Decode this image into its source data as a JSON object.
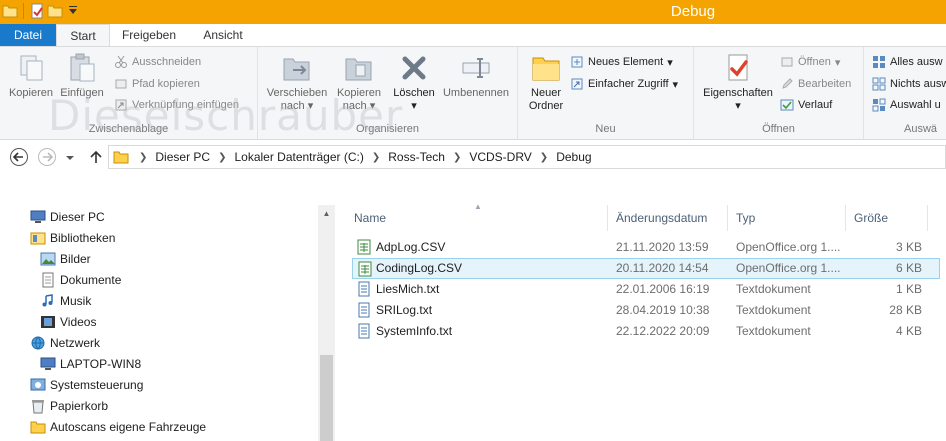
{
  "window": {
    "title": "Debug"
  },
  "tabs": {
    "file": "Datei",
    "start": "Start",
    "share": "Freigeben",
    "view": "Ansicht"
  },
  "watermark": "Dieselschrauber",
  "ribbon": {
    "clipboard": {
      "label": "Zwischenablage",
      "copy": "Kopieren",
      "paste": "Einfügen",
      "cut": "Ausschneiden",
      "copy_path": "Pfad kopieren",
      "paste_shortcut": "Verknüpfung einfügen"
    },
    "organize": {
      "label": "Organisieren",
      "move_to_1": "Verschieben",
      "move_to_2": "nach",
      "copy_to_1": "Kopieren",
      "copy_to_2": "nach",
      "delete": "Löschen",
      "rename": "Umbenennen"
    },
    "new": {
      "label": "Neu",
      "new_folder_1": "Neuer",
      "new_folder_2": "Ordner",
      "new_item": "Neues Element",
      "easy_access": "Einfacher Zugriff"
    },
    "open": {
      "label": "Öffnen",
      "properties": "Eigenschaften",
      "open": "Öffnen",
      "edit": "Bearbeiten",
      "history": "Verlauf"
    },
    "select": {
      "label": "Auswä",
      "select_all": "Alles ausw",
      "select_none": "Nichts ausw",
      "invert": "Auswahl u"
    }
  },
  "address": {
    "crumbs": [
      "Dieser PC",
      "Lokaler Datenträger (C:)",
      "Ross-Tech",
      "VCDS-DRV",
      "Debug"
    ]
  },
  "nav": [
    {
      "label": "Dieser PC",
      "icon": "computer-icon"
    },
    {
      "label": "Bibliotheken",
      "icon": "libraries-icon"
    },
    {
      "label": "Bilder",
      "icon": "pictures-icon"
    },
    {
      "label": "Dokumente",
      "icon": "documents-icon"
    },
    {
      "label": "Musik",
      "icon": "music-icon"
    },
    {
      "label": "Videos",
      "icon": "videos-icon"
    },
    {
      "label": "Netzwerk",
      "icon": "network-icon"
    },
    {
      "label": "LAPTOP-WIN8",
      "icon": "computer-icon"
    },
    {
      "label": "Systemsteuerung",
      "icon": "control-panel-icon"
    },
    {
      "label": "Papierkorb",
      "icon": "recycle-bin-icon"
    },
    {
      "label": "Autoscans eigene Fahrzeuge",
      "icon": "folder-icon"
    }
  ],
  "columns": {
    "name": "Name",
    "date": "Änderungsdatum",
    "type": "Typ",
    "size": "Größe"
  },
  "files": [
    {
      "name": "AdpLog.CSV",
      "date": "21.11.2020 13:59",
      "type": "OpenOffice.org 1....",
      "size": "3 KB",
      "kind": "csv"
    },
    {
      "name": "CodingLog.CSV",
      "date": "20.11.2020 14:54",
      "type": "OpenOffice.org 1....",
      "size": "6 KB",
      "kind": "csv"
    },
    {
      "name": "LiesMich.txt",
      "date": "22.01.2006 16:19",
      "type": "Textdokument",
      "size": "1 KB",
      "kind": "txt"
    },
    {
      "name": "SRILog.txt",
      "date": "28.04.2019 10:38",
      "type": "Textdokument",
      "size": "28 KB",
      "kind": "txt"
    },
    {
      "name": "SystemInfo.txt",
      "date": "22.12.2022 20:09",
      "type": "Textdokument",
      "size": "4 KB",
      "kind": "txt"
    }
  ],
  "selected_file_index": 1,
  "colors": {
    "titlebar": "#f4a300",
    "file_tab": "#1979ca",
    "selection": "#e5f3fb",
    "selection_border": "#99d1ef"
  }
}
